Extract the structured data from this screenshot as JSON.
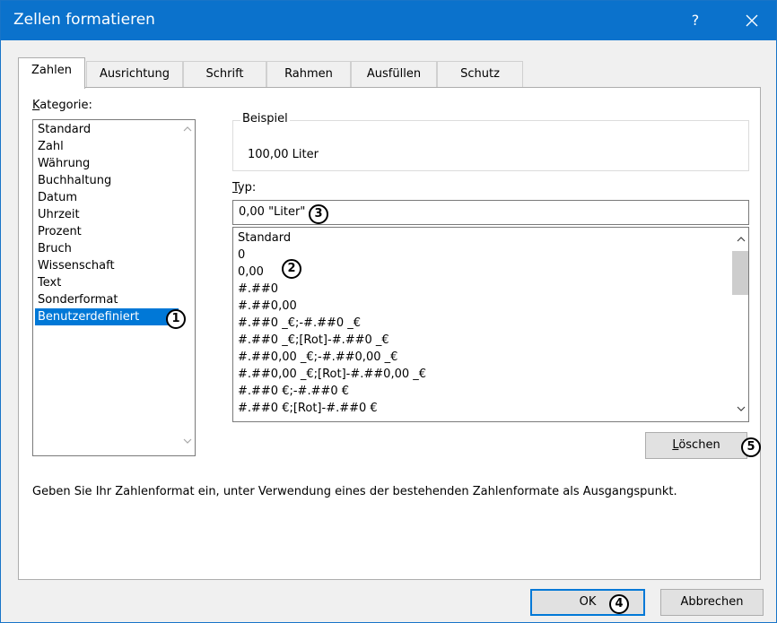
{
  "window": {
    "title": "Zellen formatieren",
    "help_label": "?",
    "accent": "#0b72cc"
  },
  "tabs": [
    {
      "label": "Zahlen",
      "active": true
    },
    {
      "label": "Ausrichtung"
    },
    {
      "label": "Schrift"
    },
    {
      "label": "Rahmen"
    },
    {
      "label": "Ausfüllen"
    },
    {
      "label": "Schutz"
    }
  ],
  "category": {
    "label_underline": "K",
    "label_rest": "ategorie:",
    "items": [
      "Standard",
      "Zahl",
      "Währung",
      "Buchhaltung",
      "Datum",
      "Uhrzeit",
      "Prozent",
      "Bruch",
      "Wissenschaft",
      "Text",
      "Sonderformat",
      "Benutzerdefiniert"
    ],
    "selected": "Benutzerdefiniert"
  },
  "sample": {
    "legend": "Beispiel",
    "value": "100,00 Liter"
  },
  "type": {
    "label_underline": "T",
    "label_rest": "yp:",
    "value": "0,00 \"Liter\"",
    "formats": [
      "Standard",
      "0",
      "0,00",
      "#.##0",
      "#.##0,00",
      "#.##0 _€;-#.##0 _€",
      "#.##0 _€;[Rot]-#.##0 _€",
      "#.##0,00 _€;-#.##0,00 _€",
      "#.##0,00 _€;[Rot]-#.##0,00 _€",
      "#.##0 €;-#.##0 €",
      "#.##0 €;[Rot]-#.##0 €"
    ]
  },
  "buttons": {
    "delete_underline": "L",
    "delete_rest": "öschen",
    "ok": "OK",
    "cancel": "Abbrechen"
  },
  "hint": "Geben Sie Ihr Zahlenformat ein, unter Verwendung eines der bestehenden Zahlenformate als Ausgangspunkt.",
  "markers": [
    "1",
    "2",
    "3",
    "4",
    "5"
  ],
  "icons": {
    "close": "close-icon",
    "scroll_up": "chevron-up-icon",
    "scroll_down": "chevron-down-icon"
  }
}
